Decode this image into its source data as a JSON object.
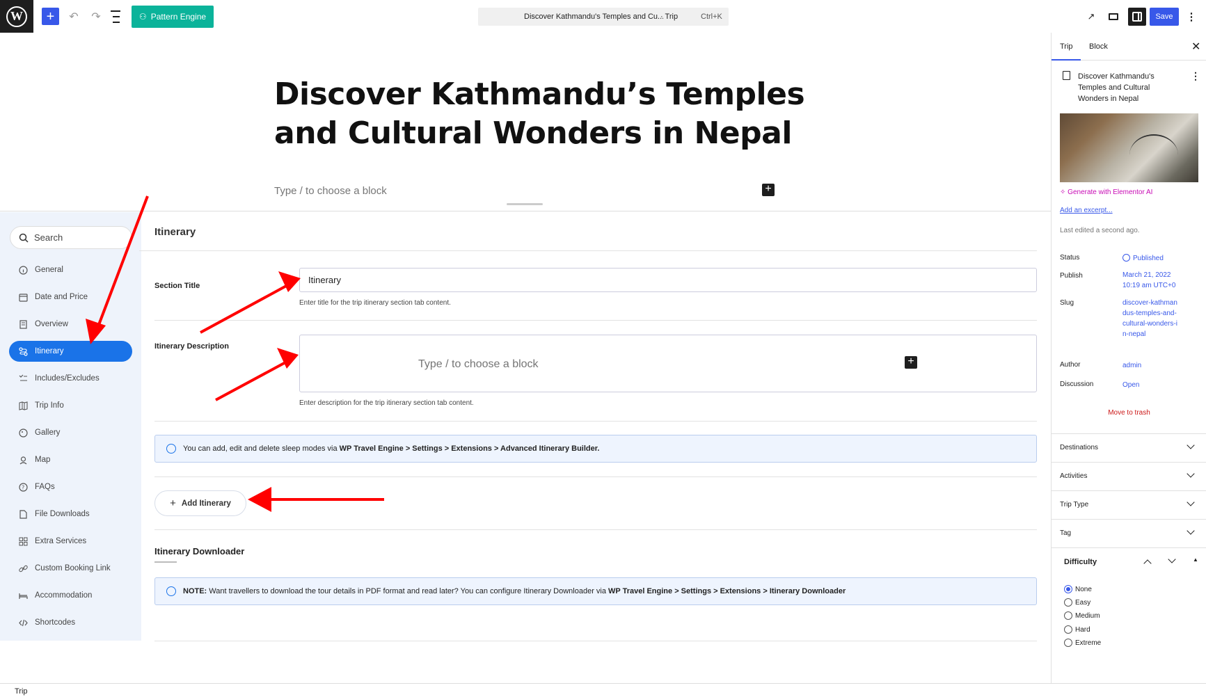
{
  "topbar": {
    "logo": "W",
    "pattern_engine": "Pattern Engine",
    "doc_title": "Discover Kathmandu's Temples and Cu...",
    "doc_type": "· Trip",
    "shortcut": "Ctrl+K",
    "save": "Save"
  },
  "editor": {
    "title": "Discover Kathmandu’s Temples and Cultural Wonders in Nepal",
    "placeholder": "Type / to choose a block"
  },
  "nav": {
    "search": "Search",
    "items": [
      {
        "label": "General",
        "icon": "info-icon"
      },
      {
        "label": "Date and Price",
        "icon": "calendar-icon"
      },
      {
        "label": "Overview",
        "icon": "document-icon"
      },
      {
        "label": "Itinerary",
        "icon": "route-icon",
        "active": true
      },
      {
        "label": "Includes/Excludes",
        "icon": "checklist-icon"
      },
      {
        "label": "Trip Info",
        "icon": "map-fold-icon"
      },
      {
        "label": "Gallery",
        "icon": "gallery-icon"
      },
      {
        "label": "Map",
        "icon": "pin-icon"
      },
      {
        "label": "FAQs",
        "icon": "question-icon"
      },
      {
        "label": "File Downloads",
        "icon": "file-icon"
      },
      {
        "label": "Extra Services",
        "icon": "grid-icon"
      },
      {
        "label": "Custom Booking Link",
        "icon": "link-icon"
      },
      {
        "label": "Accommodation",
        "icon": "bed-icon"
      },
      {
        "label": "Shortcodes",
        "icon": "code-icon"
      }
    ]
  },
  "itinerary": {
    "heading": "Itinerary",
    "section_title_label": "Section Title",
    "section_title_value": "Itinerary",
    "section_title_help": "Enter title for the trip itinerary section tab content.",
    "description_label": "Itinerary Description",
    "description_placeholder": "Type / to choose a block",
    "description_help": "Enter description for the trip itinerary section tab content.",
    "notice_prefix": "You can add, edit and delete sleep modes via ",
    "notice_bold": "WP Travel Engine > Settings > Extensions > Advanced Itinerary Builder.",
    "add_button": "Add Itinerary",
    "downloader_title": "Itinerary Downloader",
    "note_label": "NOTE:",
    "note_text": " Want travellers to download the tour details in PDF format and read later? You can configure Itinerary Downloader via ",
    "note_bold": "WP Travel Engine > Settings > Extensions > Itinerary Downloader"
  },
  "footer": {
    "breadcrumb": "Trip"
  },
  "sidebar": {
    "tab_trip": "Trip",
    "tab_block": "Block",
    "post_title": "Discover Kathmandu's Temples and Cultural Wonders in Nepal",
    "generate_ai": "Generate with Elementor AI",
    "add_excerpt": "Add an excerpt...",
    "last_edited": "Last edited a second ago.",
    "status_label": "Status",
    "status_value": "Published",
    "publish_label": "Publish",
    "publish_value": "March 21, 2022 10:19 am UTC+0",
    "slug_label": "Slug",
    "slug_value": "discover-kathmandus-temples-and-cultural-wonders-in-nepal",
    "author_label": "Author",
    "author_value": "admin",
    "discussion_label": "Discussion",
    "discussion_value": "Open",
    "trash": "Move to trash",
    "panels": [
      "Destinations",
      "Activities",
      "Trip Type",
      "Tag"
    ],
    "difficulty_title": "Difficulty",
    "difficulty_options": [
      "None",
      "Easy",
      "Medium",
      "Hard",
      "Extreme"
    ],
    "difficulty_selected": "None"
  },
  "colors": {
    "accent": "#3858e9",
    "nav_active": "#1a73e8",
    "pattern": "#0bb39a",
    "arrow": "#ff0000"
  }
}
